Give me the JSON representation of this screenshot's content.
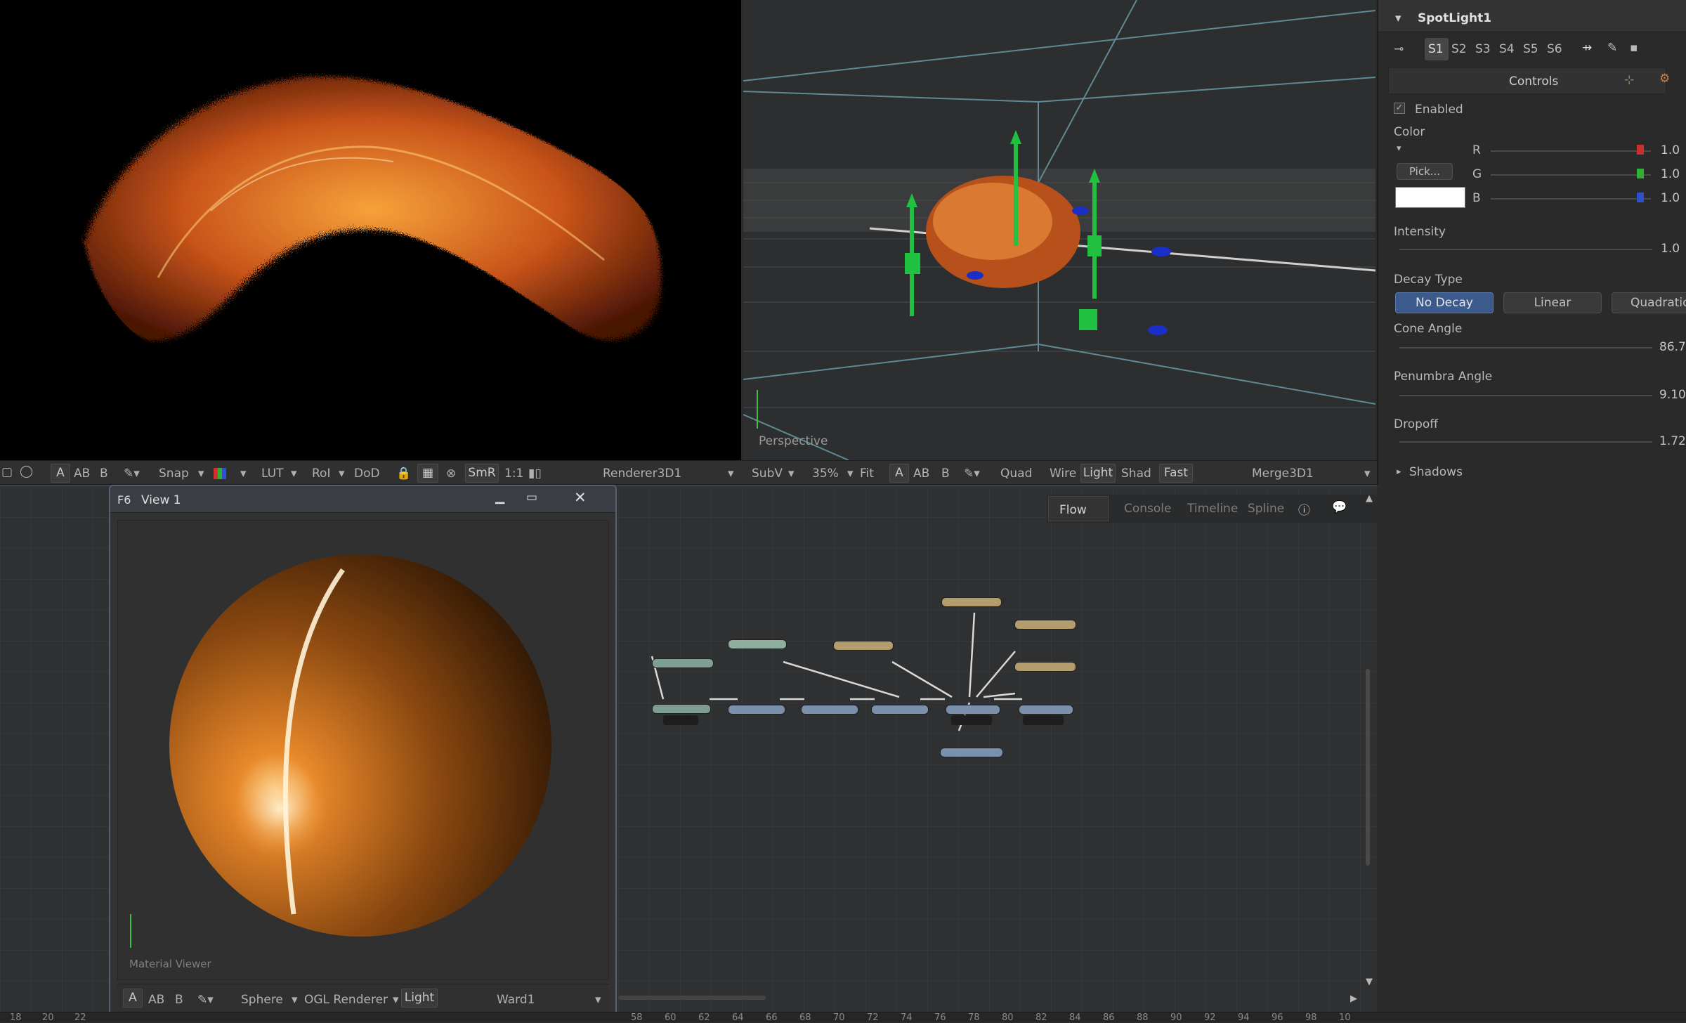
{
  "viewer_left": {
    "toolbar": {
      "a": "A",
      "ab": "AB",
      "b": "B",
      "snap": "Snap",
      "lut": "LUT",
      "roi": "RoI",
      "dod": "DoD",
      "smr": "SmR",
      "ratio": "1:1",
      "renderer": "Renderer3D1"
    }
  },
  "viewer_right": {
    "label": "Perspective",
    "toolbar": {
      "subv": "SubV",
      "zoom": "35%",
      "fit": "Fit",
      "a": "A",
      "ab": "AB",
      "b": "B",
      "quad": "Quad",
      "wire": "Wire",
      "light": "Light",
      "shad": "Shad",
      "fast": "Fast",
      "merge": "Merge3D1"
    }
  },
  "inspector": {
    "title": "SpotLight1",
    "tabs": [
      "S1",
      "S2",
      "S3",
      "S4",
      "S5",
      "S6"
    ],
    "controls_tab": "Controls",
    "enabled_label": "Enabled",
    "color_label": "Color",
    "pick_label": "Pick...",
    "channels": [
      {
        "label": "R",
        "value": "1.0"
      },
      {
        "label": "G",
        "value": "1.0"
      },
      {
        "label": "B",
        "value": "1.0"
      }
    ],
    "intensity_label": "Intensity",
    "intensity_value": "1.0",
    "decay_label": "Decay Type",
    "decay_options": [
      "No Decay",
      "Linear",
      "Quadratic"
    ],
    "cone_label": "Cone Angle",
    "cone_value": "86.7",
    "penumbra_label": "Penumbra Angle",
    "penumbra_value": "9.10",
    "dropoff_label": "Dropoff",
    "dropoff_value": "1.72",
    "shadows_label": "Shadows",
    "colors": {
      "swatch": "#ffffff",
      "active_tab": "#3c5a8c"
    }
  },
  "flow_panel": {
    "tabs": [
      "Flow",
      "Console",
      "Timeline",
      "Spline"
    ]
  },
  "view1_window": {
    "title": "View 1",
    "key": "F6",
    "label": "Material Viewer",
    "toolbar": {
      "a": "A",
      "ab": "AB",
      "b": "B",
      "sphere": "Sphere",
      "renderer": "OGL Renderer",
      "light": "Light",
      "ward": "Ward1"
    }
  },
  "ruler": {
    "left": [
      "18",
      "20",
      "22"
    ],
    "right": [
      "58",
      "60",
      "62",
      "64",
      "66",
      "68",
      "70",
      "72",
      "74",
      "76",
      "78",
      "80",
      "82",
      "84",
      "86",
      "88",
      "90",
      "92",
      "94",
      "96",
      "98",
      "10"
    ]
  }
}
